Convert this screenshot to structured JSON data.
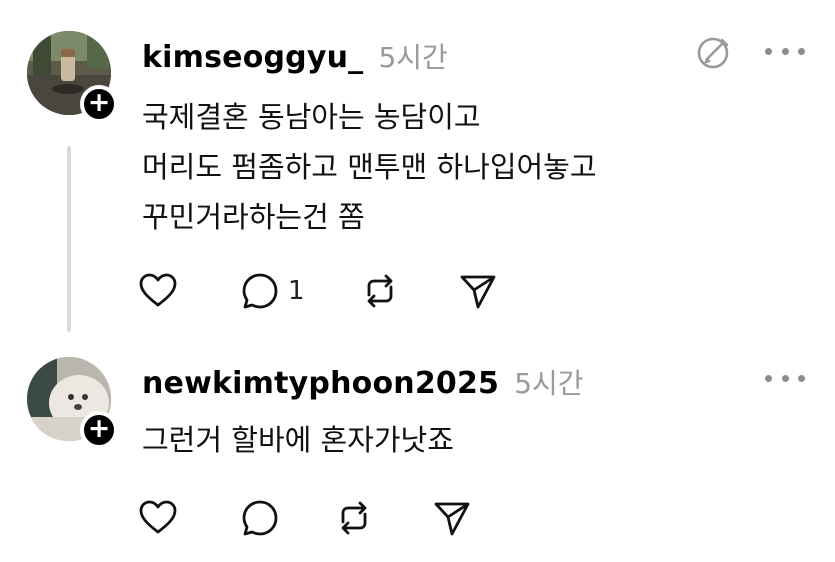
{
  "comments": [
    {
      "username": "kimseoggyu_",
      "time": "5시간",
      "lines": [
        "국제결혼 동남아는 농담이고",
        "머리도 펌좀하고 맨투맨 하나입어놓고",
        "꾸민거라하는건 쫌"
      ],
      "reply_count": "1",
      "avatar_icon": "profile-photo",
      "follow_icon": "plus-icon",
      "action_icons": [
        "heart-icon",
        "comment-icon",
        "repost-icon",
        "share-icon"
      ]
    },
    {
      "username": "newkimtyphoon2025",
      "time": "5시간",
      "lines": [
        "그런거 할바에 혼자가낫죠"
      ],
      "avatar_icon": "profile-photo",
      "follow_icon": "plus-icon",
      "action_icons": [
        "heart-icon",
        "comment-icon",
        "repost-icon",
        "share-icon"
      ]
    }
  ],
  "colors": {
    "text": "#000000",
    "muted": "#9a9a9a",
    "thread_line": "#d9d9d9"
  }
}
